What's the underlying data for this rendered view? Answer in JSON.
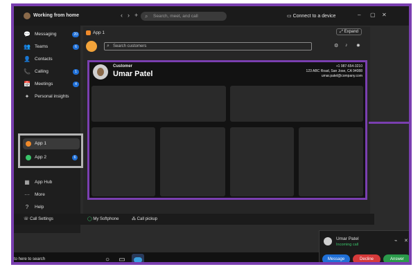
{
  "titlebar": {
    "status_text": "Working from home",
    "search_placeholder": "Search, meet, and call",
    "connect_label": "Connect to a device",
    "back_icon": "‹",
    "forward_icon": "›",
    "add_icon": "+",
    "minimize": "–",
    "maximize": "▢",
    "close": "✕"
  },
  "sidebar": {
    "items": [
      {
        "label": "Messaging",
        "icon": "💬",
        "badge": "20"
      },
      {
        "label": "Teams",
        "icon": "👥",
        "badge": "6"
      },
      {
        "label": "Contacts",
        "icon": "👤",
        "badge": ""
      },
      {
        "label": "Calling",
        "icon": "📞",
        "badge": "1"
      },
      {
        "label": "Meetings",
        "icon": "📅",
        "badge": "4"
      },
      {
        "label": "Personal insights",
        "icon": "✦",
        "badge": ""
      }
    ],
    "apps": [
      {
        "label": "App 1",
        "color": "#f08a2a",
        "badge": ""
      },
      {
        "label": "App 2",
        "color": "#3ac46a",
        "badge": "6"
      }
    ],
    "lower_items": [
      {
        "label": "App Hub",
        "icon": "▦"
      },
      {
        "label": "More",
        "icon": "···"
      },
      {
        "label": "Help",
        "icon": "?"
      }
    ]
  },
  "callbar": {
    "settings": "Call Settings",
    "softphone": "My Softphone",
    "pickup": "Call pickup"
  },
  "main": {
    "app_tab": "App 1",
    "expand_label": "Expand",
    "search_placeholder": "Search customers"
  },
  "customer": {
    "label": "Customer",
    "name": "Umar Patel",
    "phone": "+1 987-654-3210",
    "address": "123 ABC Road, San Jose, CA 94088",
    "email": "umar.patel@company.com"
  },
  "taskbar": {
    "search_text": "to here to search"
  },
  "toast": {
    "caller": "Umar Patel",
    "status": "Incoming call",
    "message": "Message",
    "decline": "Decline",
    "answer": "Answer"
  },
  "colors": {
    "frame": "#7a3fb0",
    "message_btn": "#1f6fd6",
    "decline_btn": "#d63a3a",
    "answer_btn": "#2a9a4a"
  }
}
